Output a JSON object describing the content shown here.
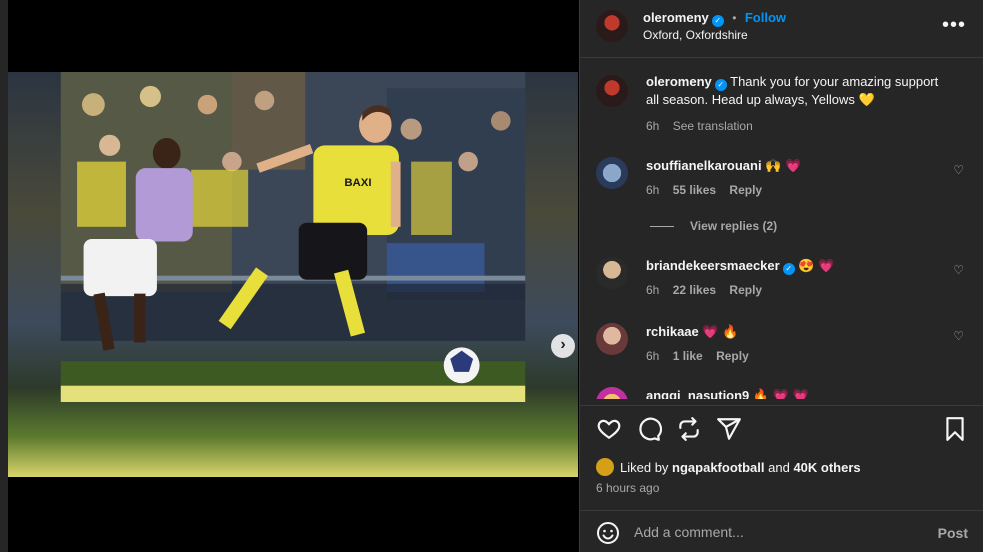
{
  "post": {
    "author": "oleromeny",
    "follow_label": "Follow",
    "separator": "•",
    "location": "Oxford, Oxfordshire",
    "more_label": "•••",
    "verified_mark": "✓"
  },
  "caption": {
    "author": "oleromeny",
    "text": "Thank you for your amazing support all season. Head up always, Yellows 💛",
    "time": "6h",
    "translate_label": "See translation"
  },
  "comments": [
    {
      "author": "souffianelkarouani",
      "verified": false,
      "text": "🙌 💗",
      "time": "6h",
      "likes": "55 likes",
      "reply_label": "Reply"
    },
    {
      "author": "briandekeersmaecker",
      "verified": true,
      "text": "😍 💗",
      "time": "6h",
      "likes": "22 likes",
      "reply_label": "Reply"
    },
    {
      "author": "rchikaae",
      "verified": false,
      "text": "💗 🔥",
      "time": "6h",
      "likes": "1 like",
      "reply_label": "Reply"
    },
    {
      "author": "anggi_nasution9",
      "verified": false,
      "text": "🔥 💗 💗"
    }
  ],
  "view_replies": "View replies (2)",
  "likes": {
    "prefix": "Liked by",
    "user": "ngapakfootball",
    "middle": "and",
    "others": "40K others"
  },
  "timestamp": "6 hours ago",
  "composer": {
    "placeholder": "Add a comment...",
    "post_label": "Post"
  },
  "media": {
    "next_label": "›",
    "slide_index": 1,
    "slide_count": 2
  },
  "colors": {
    "accent": "#0095f6",
    "panel_bg": "#262626",
    "muted": "#a8a8a8"
  }
}
